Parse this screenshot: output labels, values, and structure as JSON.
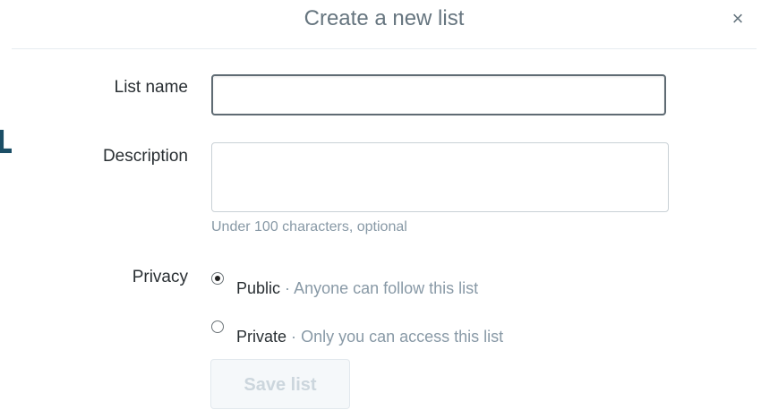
{
  "background": {
    "partial_heading": "List"
  },
  "modal": {
    "title": "Create a new list",
    "close_glyph": "×",
    "form": {
      "name_label": "List name",
      "name_value": "",
      "description_label": "Description",
      "description_value": "",
      "description_hint": "Under 100 characters, optional",
      "privacy_label": "Privacy",
      "privacy_options": [
        {
          "label": "Public",
          "separator": "·",
          "description": "Anyone can follow this list",
          "selected": true
        },
        {
          "label": "Private",
          "separator": "·",
          "description": "Only you can access this list",
          "selected": false
        }
      ],
      "save_label": "Save list",
      "save_enabled": false
    }
  },
  "colors": {
    "heading_bg_text": "#1b4e66",
    "title_text": "#66757f",
    "muted_text": "#8899a6",
    "button_disabled_bg": "#f5f8fa",
    "button_disabled_text": "#ccd6dd",
    "input_focus_border": "#5f6b73"
  },
  "icons": {
    "close": "close-icon"
  }
}
